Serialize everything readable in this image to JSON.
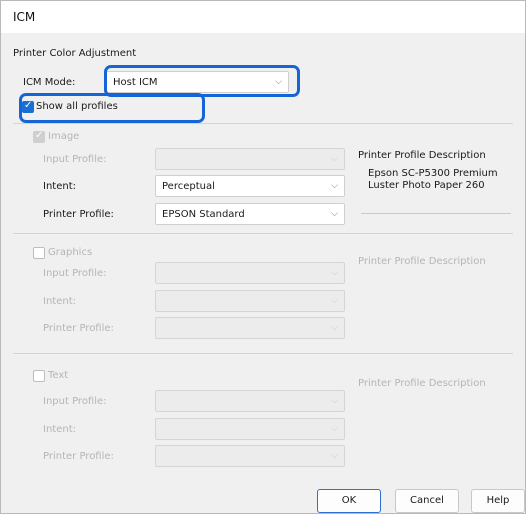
{
  "window": {
    "title": "ICM"
  },
  "adjustment": {
    "section_title": "Printer Color Adjustment"
  },
  "icm_mode": {
    "label": "ICM Mode:",
    "value": "Host ICM"
  },
  "show_all_profiles": {
    "label": "Show all profiles",
    "checked": true
  },
  "image": {
    "label": "Image",
    "input_profile_label": "Input Profile:",
    "input_profile_value": "",
    "intent_label": "Intent:",
    "intent_value": "Perceptual",
    "printer_profile_label": "Printer Profile:",
    "printer_profile_value": "EPSON Standard",
    "description_title": "Printer Profile Description",
    "description_line1": "Epson SC-P5300 Premium",
    "description_line2": "Luster Photo Paper 260"
  },
  "graphics": {
    "label": "Graphics",
    "input_profile_label": "Input Profile:",
    "intent_label": "Intent:",
    "printer_profile_label": "Printer Profile:",
    "description_title": "Printer Profile Description"
  },
  "text": {
    "label": "Text",
    "input_profile_label": "Input Profile:",
    "intent_label": "Intent:",
    "printer_profile_label": "Printer Profile:",
    "description_title": "Printer Profile Description"
  },
  "buttons": {
    "ok": "OK",
    "cancel": "Cancel",
    "help": "Help"
  },
  "colors": {
    "highlight": "#1665d8",
    "checkbox": "#1a6fd6"
  }
}
